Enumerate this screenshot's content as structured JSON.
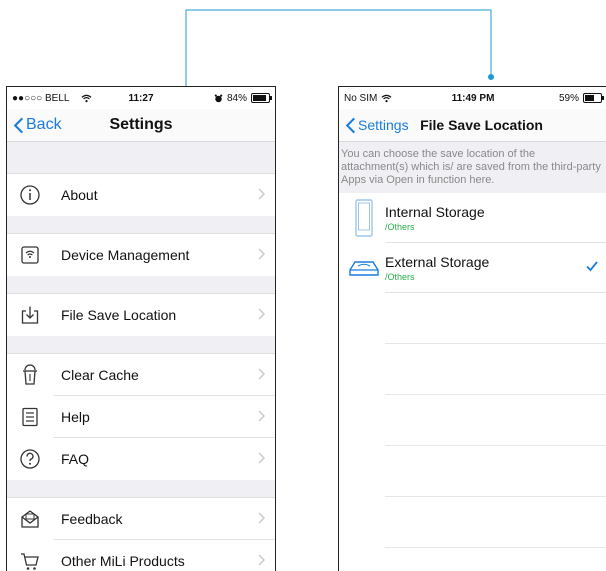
{
  "left": {
    "status": {
      "carrier": "●●○○○ BELL",
      "time": "11:27",
      "battery": "84%",
      "battery_level": 0.84
    },
    "nav": {
      "back_label": "Back",
      "title": "Settings"
    },
    "rows": [
      {
        "label": "About",
        "icon": "info-icon"
      },
      {
        "label": "Device Management",
        "icon": "device-icon"
      },
      {
        "label": "File Save Location",
        "icon": "download-icon"
      },
      {
        "label": "Clear Cache",
        "icon": "trash-icon"
      },
      {
        "label": "Help",
        "icon": "document-icon"
      },
      {
        "label": "FAQ",
        "icon": "question-icon"
      },
      {
        "label": "Feedback",
        "icon": "mail-icon"
      },
      {
        "label": "Other MiLi Products",
        "icon": "cart-icon"
      }
    ]
  },
  "right": {
    "status": {
      "carrier": "No SIM",
      "time": "11:49 PM",
      "battery": "59%",
      "battery_level": 0.59
    },
    "nav": {
      "back_label": "Settings",
      "title": "File Save Location"
    },
    "description": "You can choose the save location of the attachment(s) which is/ are saved from the third-party Apps via Open in function here.",
    "options": [
      {
        "title": "Internal Storage",
        "subtitle": "/Others",
        "icon": "phone-icon",
        "selected": false
      },
      {
        "title": "External Storage",
        "subtitle": "/Others",
        "icon": "drive-icon",
        "selected": true
      }
    ]
  },
  "colors": {
    "accent": "#1a7de0",
    "subtitle_green": "#27b24a",
    "connector": "#1b9bd6"
  }
}
